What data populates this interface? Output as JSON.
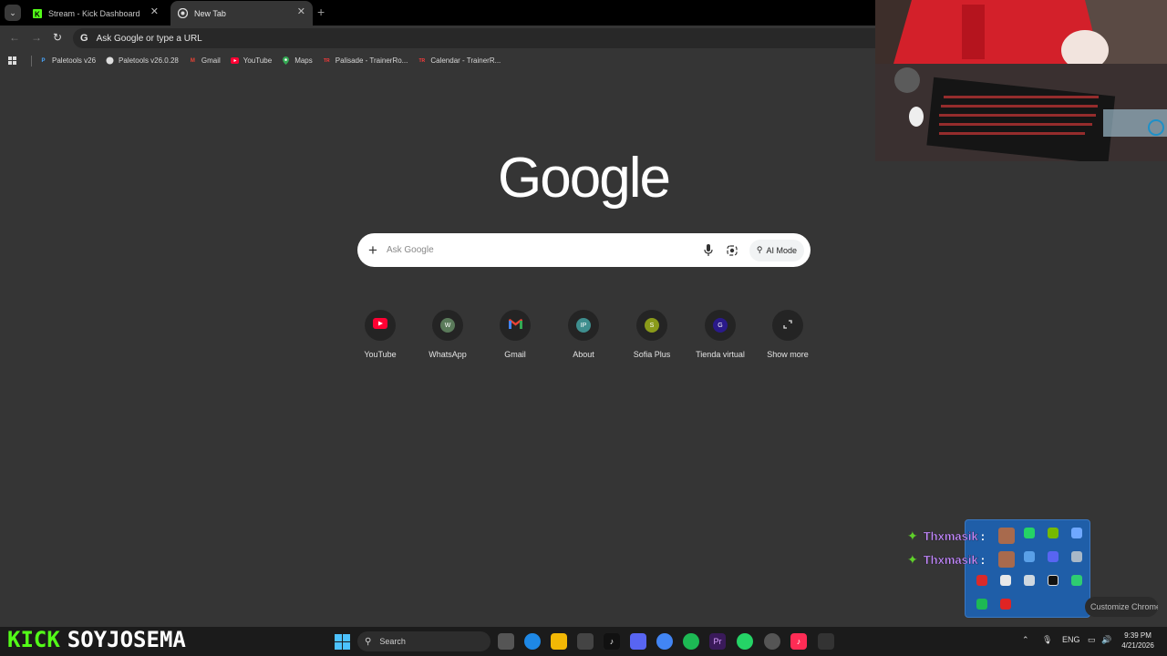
{
  "tabs": [
    {
      "title": "Stream - Kick Dashboard",
      "active": false
    },
    {
      "title": "New Tab",
      "active": true
    }
  ],
  "toolbar": {
    "omnibox_placeholder": "Ask Google or type a URL"
  },
  "bookmarks": [
    {
      "label": "Paletools v26",
      "icon": "paletools-icon"
    },
    {
      "label": "Paletools v26.0.28",
      "icon": "paletools-icon"
    },
    {
      "label": "Gmail",
      "icon": "gmail-icon"
    },
    {
      "label": "YouTube",
      "icon": "youtube-icon"
    },
    {
      "label": "Maps",
      "icon": "maps-icon"
    },
    {
      "label": "Palisade - TrainerRo...",
      "icon": "trainer-icon"
    },
    {
      "label": "Calendar - TrainerR...",
      "icon": "trainer-icon"
    }
  ],
  "google": {
    "logo_text": "Google",
    "search_placeholder": "Ask Google",
    "ai_mode_label": "AI Mode"
  },
  "shortcuts": [
    {
      "label": "YouTube",
      "letter": "",
      "color": "#ff0033"
    },
    {
      "label": "WhatsApp",
      "letter": "W",
      "color": "#5a7a5a"
    },
    {
      "label": "Gmail",
      "letter": "M",
      "color": "#242424"
    },
    {
      "label": "About",
      "letter": "IP",
      "color": "#3e8e8e"
    },
    {
      "label": "Sofia Plus",
      "letter": "S",
      "color": "#8a9a1a"
    },
    {
      "label": "Tienda virtual",
      "letter": "G",
      "color": "#2a1a8a"
    },
    {
      "label": "Show more",
      "letter": "",
      "color": "#242424"
    }
  ],
  "chat": [
    {
      "user": "Thxmasik",
      "sep": ":"
    },
    {
      "user": "Thxmasik",
      "sep": ":"
    }
  ],
  "customize_label": "Customize Chrome",
  "overlay": {
    "brand": "KICK",
    "channel": "SOYJOSEMA"
  },
  "taskbar": {
    "search_label": "Search",
    "language": "ENG",
    "time": "9:39 PM",
    "date": "4/21/2026"
  },
  "colors": {
    "accent_kick": "#53fc18",
    "background": "#353535"
  }
}
